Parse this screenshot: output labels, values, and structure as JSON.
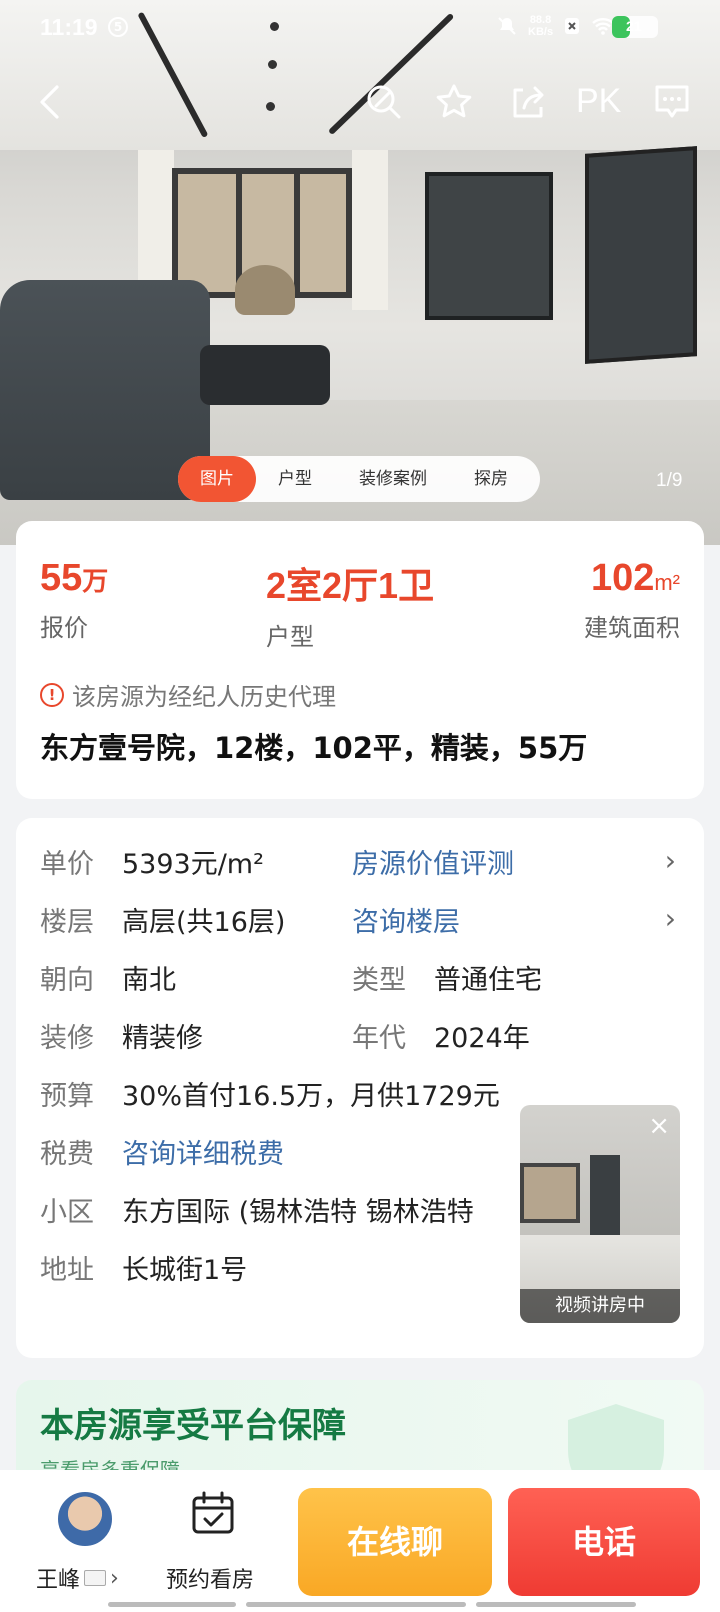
{
  "status_bar": {
    "time": "11:19",
    "badge": "5",
    "speed_value": "88.8",
    "speed_unit": "KB/s",
    "battery": "21",
    "battery_color": "#3cc45c"
  },
  "nav": {
    "pk_label": "PK"
  },
  "photo_tabs": [
    {
      "label": "图片",
      "active": true
    },
    {
      "label": "户型",
      "active": false
    },
    {
      "label": "装修案例",
      "active": false
    },
    {
      "label": "探房",
      "active": false
    }
  ],
  "photo_index": "1/9",
  "summary": {
    "price": {
      "num": "55",
      "unit": "万",
      "label": "报价"
    },
    "layout": {
      "value": "2室2厅1卫",
      "label": "户型"
    },
    "area": {
      "num": "102",
      "unit": "m²",
      "label": "建筑面积"
    },
    "notice": "该房源为经纪人历史代理",
    "headline": "东方壹号院，12楼，102平，精装，55万"
  },
  "details": {
    "unit_price": {
      "key": "单价",
      "value": "5393元/m²"
    },
    "value_eval": {
      "label": "房源价值评测"
    },
    "floor": {
      "key": "楼层",
      "value": "高层(共16层)"
    },
    "consult_floor": {
      "label": "咨询楼层"
    },
    "orientation": {
      "key": "朝向",
      "value": "南北"
    },
    "type": {
      "key": "类型",
      "value": "普通住宅"
    },
    "decoration": {
      "key": "装修",
      "value": "精装修"
    },
    "year": {
      "key": "年代",
      "value": "2024年"
    },
    "budget": {
      "key": "预算",
      "value": "30%首付16.5万，月供1729元"
    },
    "tax": {
      "key": "税费",
      "value": "咨询详细税费"
    },
    "community": {
      "key": "小区",
      "value": "东方国际 (锡林浩特 锡林浩特"
    },
    "address": {
      "key": "地址",
      "value": "长城街1号"
    }
  },
  "guarantee": {
    "title": "本房源享受平台保障",
    "subtitle": "享看房多重保障"
  },
  "video": {
    "caption": "视频讲房中"
  },
  "bottom": {
    "agent_name": "王峰",
    "book_label": "预约看房",
    "chat_label": "在线聊",
    "call_label": "电话"
  },
  "colors": {
    "accent": "#e8472c",
    "link": "#3d6da8",
    "chat_btn": "#f9a825",
    "call_btn": "#ef3b33"
  }
}
